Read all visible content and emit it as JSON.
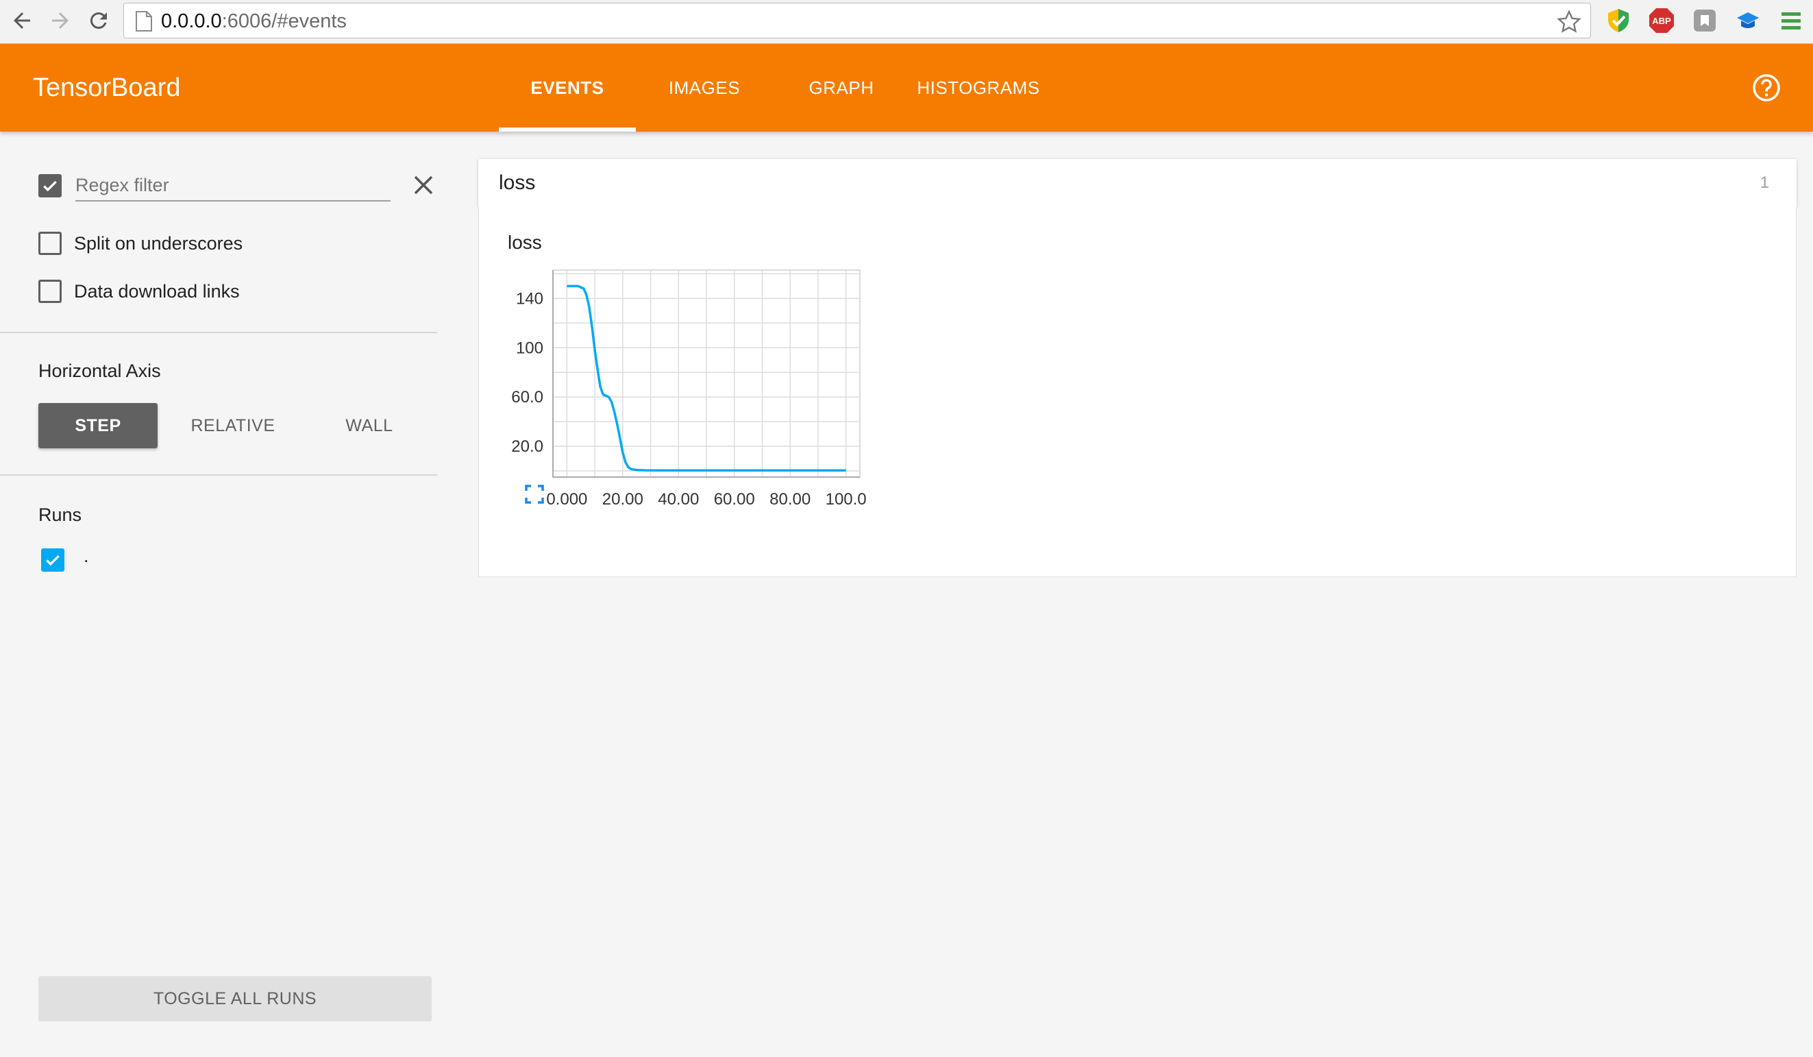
{
  "browser": {
    "url_host": "0.0.0.0",
    "url_rest": ":6006/#events",
    "extensions": [
      "shield-check-icon",
      "abp-icon",
      "ghostery-icon",
      "cap-icon",
      "menu-icon"
    ],
    "abp_label": "ABP"
  },
  "app": {
    "brand": "TensorBoard",
    "tabs": [
      {
        "label": "EVENTS",
        "selected": true
      },
      {
        "label": "IMAGES",
        "selected": false
      },
      {
        "label": "GRAPH",
        "selected": false
      },
      {
        "label": "HISTOGRAMS",
        "selected": false
      }
    ],
    "accent_color": "#f57c00"
  },
  "sidebar": {
    "regex_filter": {
      "checked": true,
      "placeholder": "Regex filter",
      "value": ""
    },
    "split_on_underscores": {
      "label": "Split on underscores",
      "checked": false
    },
    "data_download_links": {
      "label": "Data download links",
      "checked": false
    },
    "horizontal_axis": {
      "title": "Horizontal Axis",
      "options": [
        {
          "label": "STEP",
          "selected": true
        },
        {
          "label": "RELATIVE",
          "selected": false
        },
        {
          "label": "WALL",
          "selected": false
        }
      ]
    },
    "runs": {
      "title": "Runs",
      "items": [
        {
          "name": ".",
          "checked": true,
          "color": "#03a9f4"
        }
      ]
    },
    "toggle_all_label": "TOGGLE ALL RUNS"
  },
  "main": {
    "category": {
      "name": "loss",
      "count": "1"
    },
    "chart_title": "loss"
  },
  "chart_data": {
    "type": "line",
    "title": "loss",
    "xlabel": "",
    "ylabel": "",
    "xlim": [
      -5,
      105
    ],
    "ylim": [
      -5,
      163
    ],
    "x_ticks": [
      "0.000",
      "20.00",
      "40.00",
      "60.00",
      "80.00",
      "100.0"
    ],
    "y_ticks": [
      "20.0",
      "60.0",
      "100",
      "140"
    ],
    "grid": true,
    "series": [
      {
        "color": "#03a9f4",
        "x": [
          0,
          2,
          4,
          6,
          7,
          8,
          9,
          10,
          11,
          12,
          13,
          14,
          15,
          16,
          17,
          18,
          19,
          20,
          21,
          22,
          23,
          25,
          28,
          35,
          50,
          70,
          100
        ],
        "y": [
          150,
          150,
          150,
          148,
          143,
          133,
          117,
          98,
          82,
          68,
          62,
          61,
          60,
          56,
          48,
          38,
          27,
          15,
          7,
          3,
          1.5,
          0.8,
          0.5,
          0.4,
          0.4,
          0.4,
          0.4
        ]
      }
    ]
  }
}
